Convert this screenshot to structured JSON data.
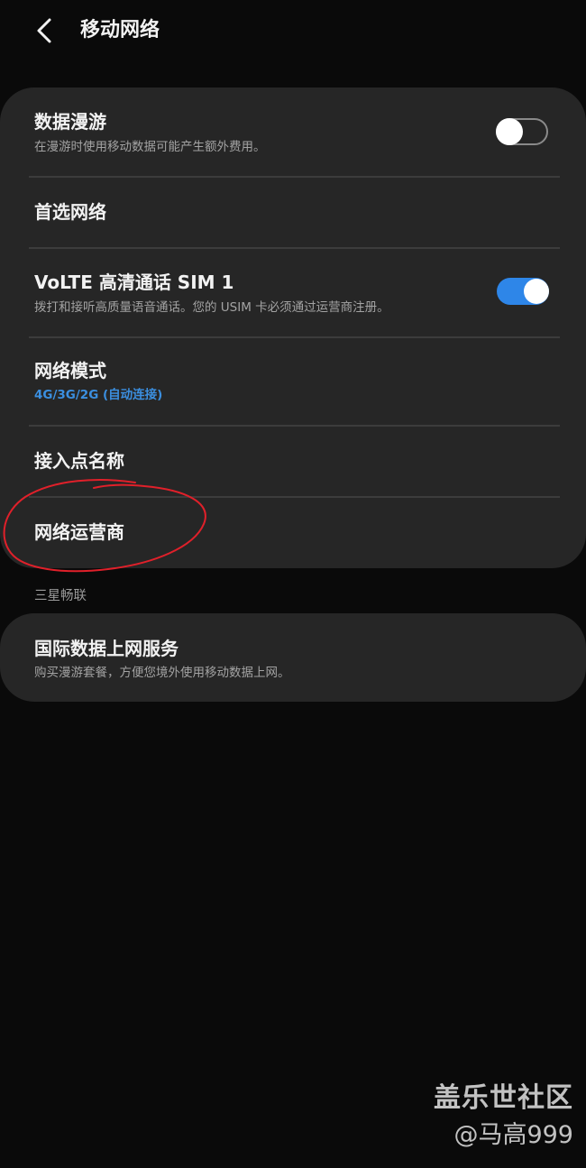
{
  "header": {
    "title": "移动网络",
    "back_icon": "chevron-left-icon"
  },
  "settings": [
    {
      "title": "数据漫游",
      "subtitle": "在漫游时使用移动数据可能产生额外费用。",
      "toggle": "off"
    },
    {
      "title": "首选网络"
    },
    {
      "title": "VoLTE 高清通话 SIM 1",
      "subtitle": "拨打和接听高质量语音通话。您的 USIM 卡必须通过运营商注册。",
      "toggle": "on"
    },
    {
      "title": "网络模式",
      "value": "4G/3G/2G (自动连接)"
    },
    {
      "title": "接入点名称"
    },
    {
      "title": "网络运营商"
    }
  ],
  "section": {
    "label": "三星畅联",
    "items": [
      {
        "title": "国际数据上网服务",
        "subtitle": "购买漫游套餐，方便您境外使用移动数据上网。"
      }
    ]
  },
  "watermark": {
    "line1": "盖乐世社区",
    "line2": "@马高999"
  },
  "colors": {
    "background": "#0a0a0a",
    "card": "#262626",
    "accent": "#2e86e8",
    "annotation": "#e0202a"
  }
}
